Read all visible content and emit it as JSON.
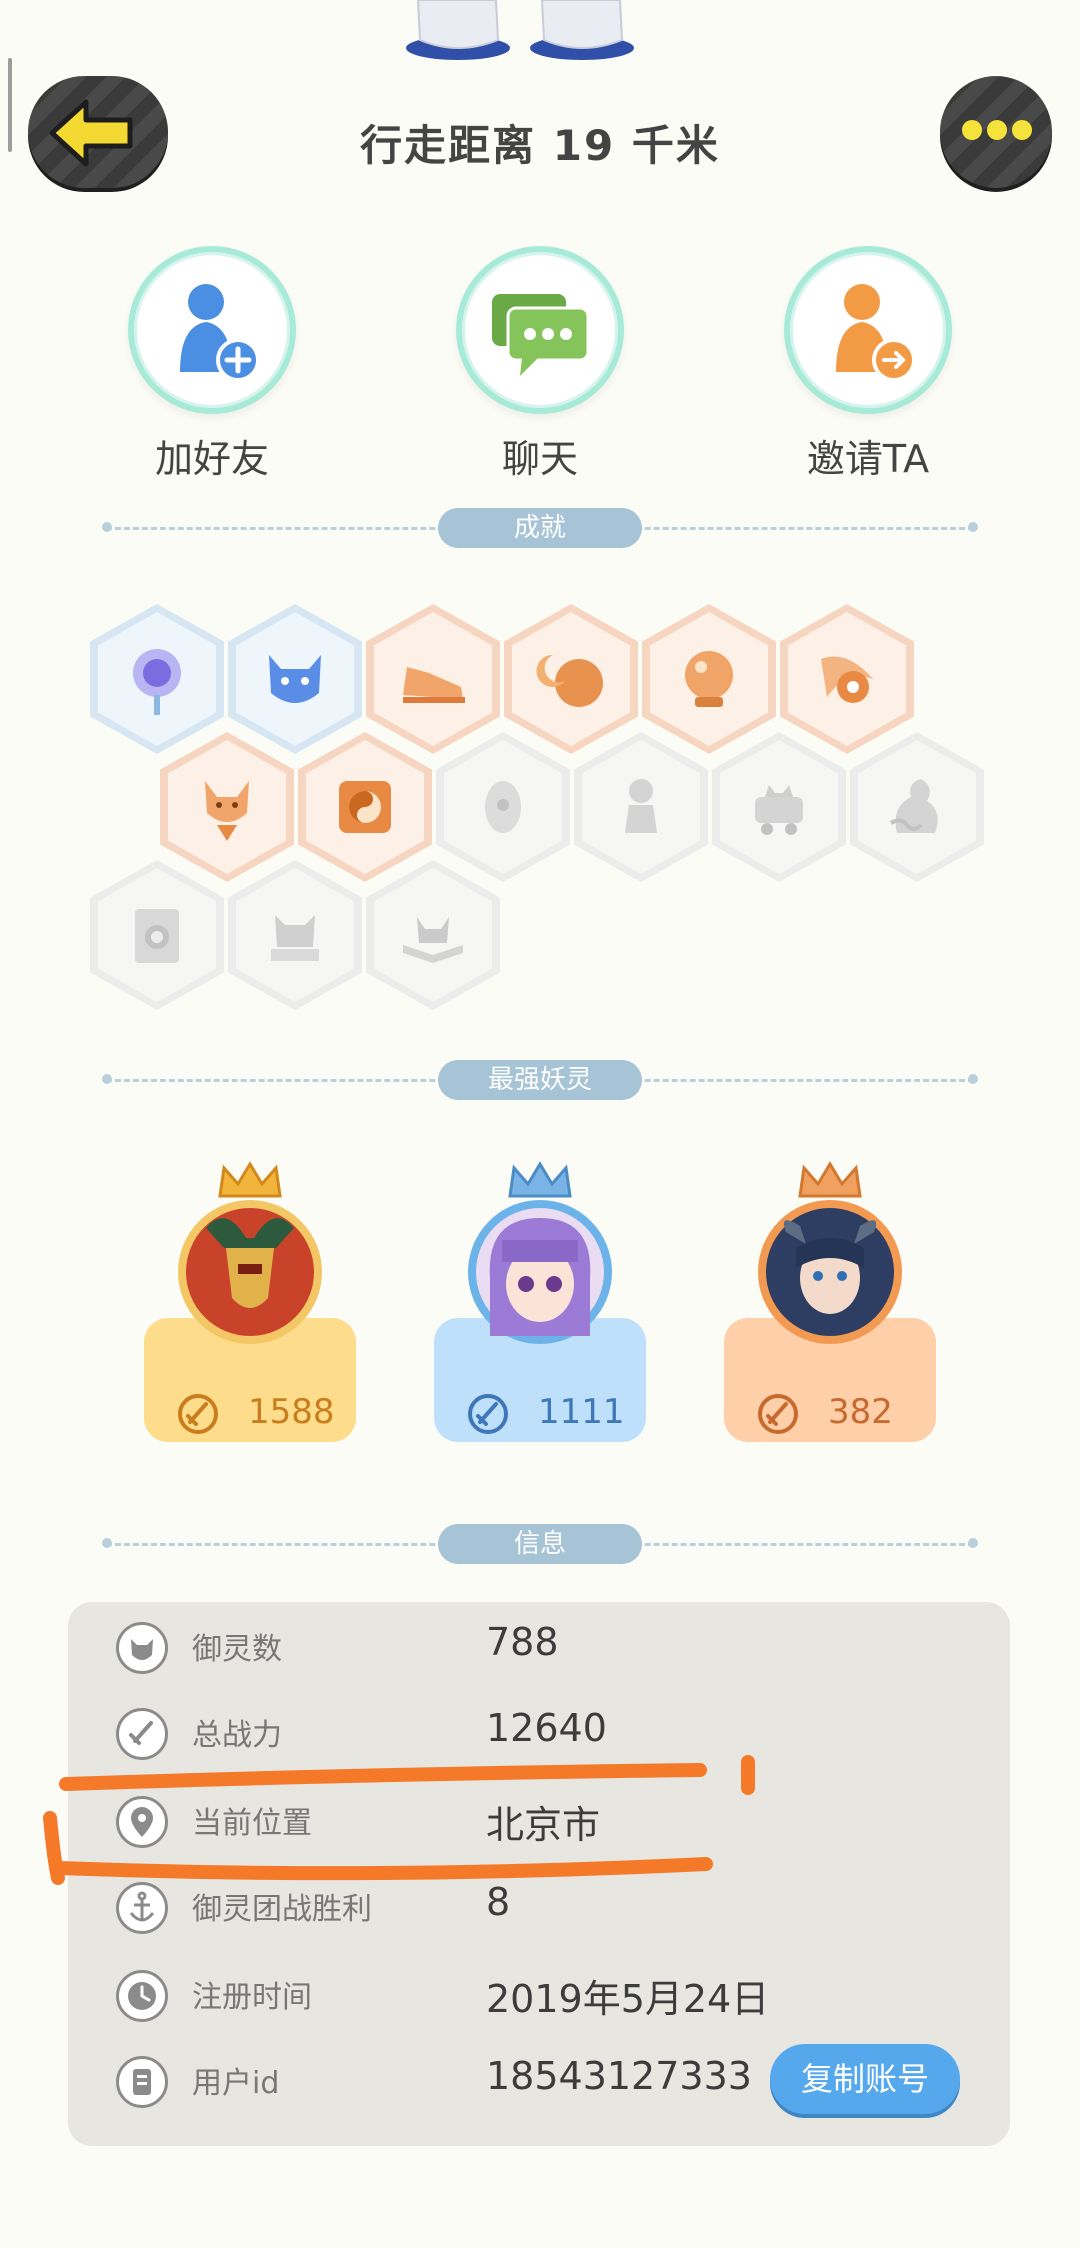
{
  "header": {
    "title": "行走距离 19 千米"
  },
  "actions": [
    {
      "label": "加好友",
      "icon": "add-friend-icon"
    },
    {
      "label": "聊天",
      "icon": "chat-icon"
    },
    {
      "label": "邀请TA",
      "icon": "invite-icon"
    }
  ],
  "sections": {
    "achievements": "成就",
    "strongest": "最强妖灵",
    "info": "信息"
  },
  "achievements": {
    "badges": [
      {
        "style": "blue",
        "icon": "portal-badge-icon"
      },
      {
        "style": "blue",
        "icon": "cat-ghost-badge-icon"
      },
      {
        "style": "orange",
        "icon": "sneaker-badge-icon"
      },
      {
        "style": "orange",
        "icon": "moon-badge-icon"
      },
      {
        "style": "orange",
        "icon": "crystal-ball-badge-icon"
      },
      {
        "style": "orange",
        "icon": "yin-yang-comet-badge-icon"
      },
      {
        "style": "orange",
        "icon": "fox-badge-icon"
      },
      {
        "style": "orange",
        "icon": "yin-yang-badge-icon"
      },
      {
        "style": "gray",
        "icon": "egg-badge-icon"
      },
      {
        "style": "gray",
        "icon": "statue-badge-icon"
      },
      {
        "style": "gray",
        "icon": "cart-badge-icon"
      },
      {
        "style": "gray",
        "icon": "dragon-badge-icon"
      },
      {
        "style": "gray",
        "icon": "scroll-badge-icon"
      },
      {
        "style": "gray",
        "icon": "demon-badge-icon"
      },
      {
        "style": "gray",
        "icon": "book-badge-icon"
      }
    ]
  },
  "spirits": [
    {
      "power": "1588",
      "card_color": "#fddc8c",
      "power_color": "#c97d1c",
      "crown_color": "#f2b53b"
    },
    {
      "power": "1111",
      "card_color": "#bfe0fb",
      "power_color": "#3f78b8",
      "crown_color": "#7ab4e6"
    },
    {
      "power": "382",
      "card_color": "#fecfa8",
      "power_color": "#c86a2f",
      "crown_color": "#f1a15f"
    }
  ],
  "info": {
    "rows": [
      {
        "key": "御灵数",
        "value": "788",
        "icon": "spirit-count-icon"
      },
      {
        "key": "总战力",
        "value": "12640",
        "icon": "sword-icon"
      },
      {
        "key": "当前位置",
        "value": "北京市",
        "icon": "location-pin-icon"
      },
      {
        "key": "御灵团战胜利",
        "value": "8",
        "icon": "anchor-icon"
      },
      {
        "key": "注册时间",
        "value": "2019年5月24日",
        "icon": "clock-icon"
      },
      {
        "key": "用户id",
        "value": "18543127333",
        "icon": "id-card-icon"
      }
    ],
    "copy_label": "复制账号"
  },
  "colors": {
    "annotation": "#f47a2a",
    "copy_button": "#55a8ec",
    "back_arrow": "#f5d933"
  }
}
